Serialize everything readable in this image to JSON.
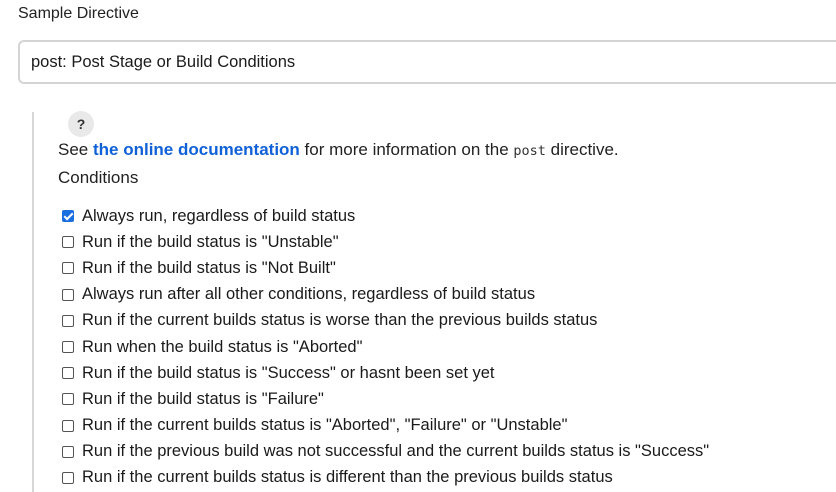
{
  "directive_label": "Sample Directive",
  "directive_select": {
    "value": "post: Post Stage or Build Conditions"
  },
  "help_button": "?",
  "info": {
    "prefix": "See ",
    "link": "the online documentation",
    "middle": " for more information on the ",
    "code": "post",
    "suffix": " directive."
  },
  "conditions_label": "Conditions",
  "conditions": [
    {
      "label": "Always run, regardless of build status",
      "checked": true
    },
    {
      "label": "Run if the build status is \"Unstable\"",
      "checked": false
    },
    {
      "label": "Run if the build status is \"Not Built\"",
      "checked": false
    },
    {
      "label": "Always run after all other conditions, regardless of build status",
      "checked": false
    },
    {
      "label": "Run if the current builds status is worse than the previous builds status",
      "checked": false
    },
    {
      "label": "Run when the build status is \"Aborted\"",
      "checked": false
    },
    {
      "label": "Run if the build status is \"Success\" or hasnt been set yet",
      "checked": false
    },
    {
      "label": "Run if the build status is \"Failure\"",
      "checked": false
    },
    {
      "label": "Run if the current builds status is \"Aborted\", \"Failure\" or \"Unstable\"",
      "checked": false
    },
    {
      "label": "Run if the previous build was not successful and the current builds status is \"Success\"",
      "checked": false
    },
    {
      "label": "Run if the current builds status is different than the previous builds status",
      "checked": false
    }
  ],
  "colors": {
    "link": "#1061d8",
    "checkbox_checked": "#1a6fe0"
  }
}
